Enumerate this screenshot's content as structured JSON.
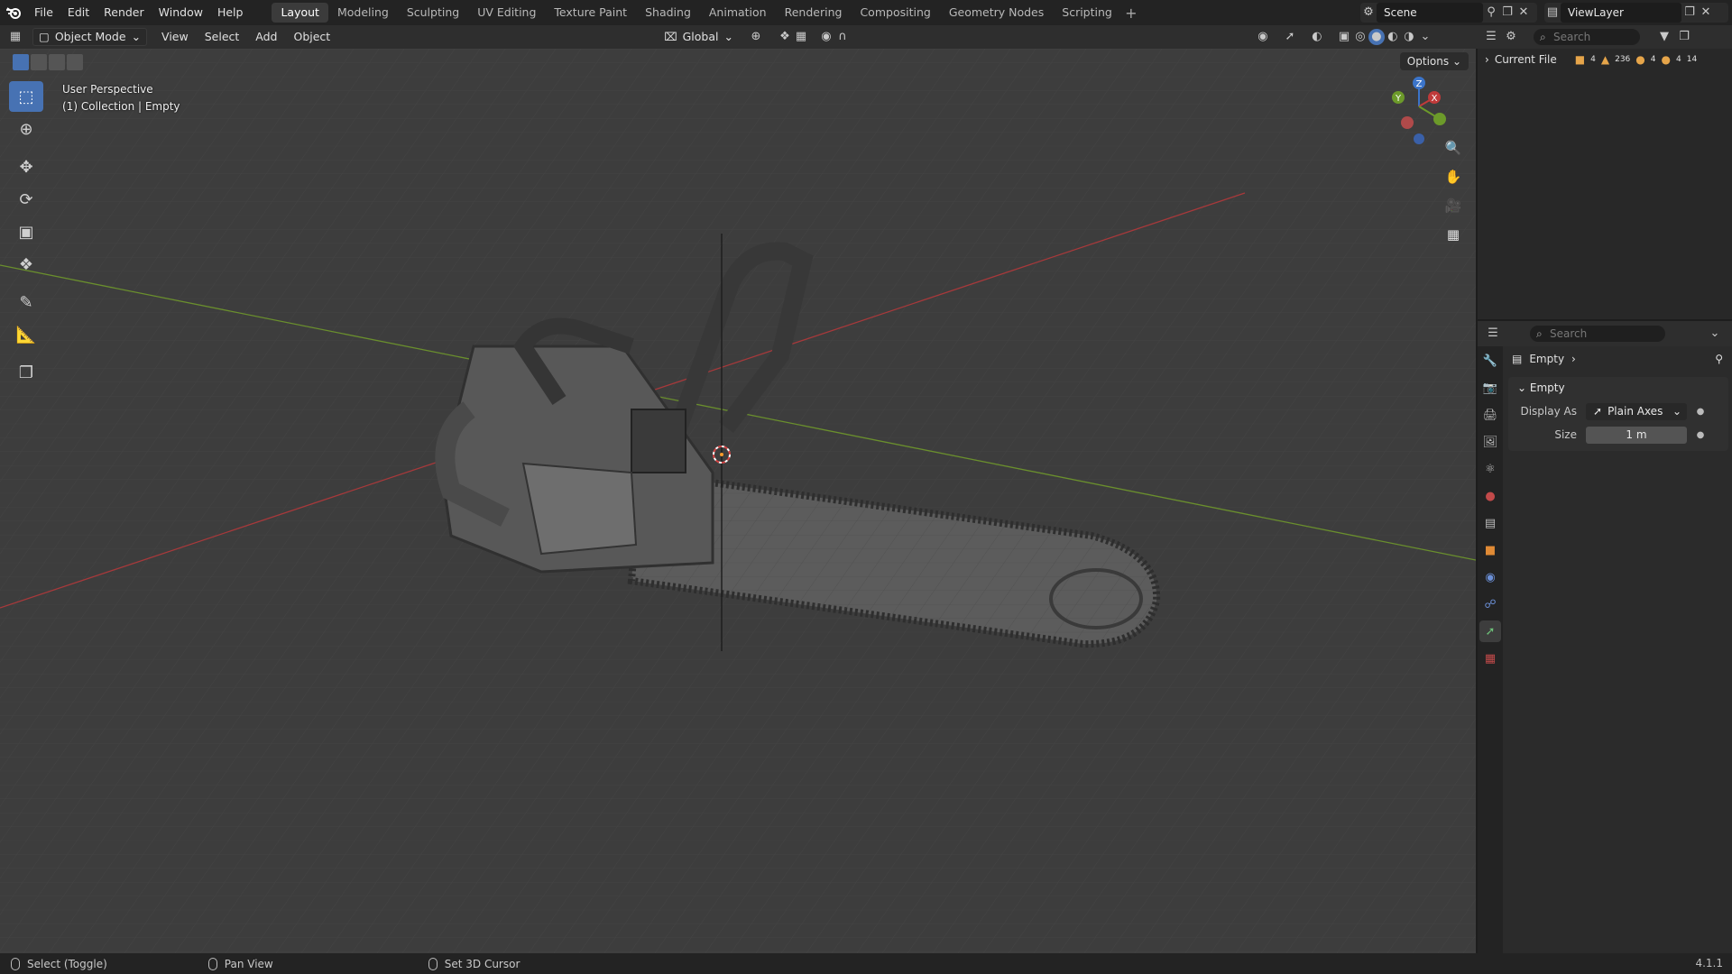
{
  "menu": {
    "items": [
      "File",
      "Edit",
      "Render",
      "Window",
      "Help"
    ]
  },
  "workspaces": {
    "tabs": [
      "Layout",
      "Modeling",
      "Sculpting",
      "UV Editing",
      "Texture Paint",
      "Shading",
      "Animation",
      "Rendering",
      "Compositing",
      "Geometry Nodes",
      "Scripting"
    ],
    "active": "Layout",
    "add_label": "+"
  },
  "scene": {
    "name": "Scene"
  },
  "view_layer": {
    "name": "ViewLayer"
  },
  "viewport_header": {
    "mode": "Object Mode",
    "menus": [
      "View",
      "Select",
      "Add",
      "Object"
    ],
    "orientation": "Global",
    "options_label": "Options"
  },
  "viewport": {
    "perspective_label": "User Perspective",
    "collection_label": "(1) Collection | Empty",
    "gizmo": {
      "x_label": "X",
      "y_label": "Y",
      "z_label": "Z"
    },
    "colors": {
      "x_axis": "#c03a3a",
      "y_axis": "#6c9a2a",
      "z_axis": "#3b74c9",
      "active_tool": "#4772b3"
    }
  },
  "tools": [
    "select-box",
    "cursor",
    "move",
    "rotate",
    "scale",
    "transform",
    "annotate",
    "measure",
    "add-cube"
  ],
  "outliner": {
    "search_placeholder": "Search",
    "current_file": "Current File",
    "counts": [
      "4",
      "236",
      "4",
      "4",
      "14"
    ]
  },
  "properties": {
    "search_placeholder": "Search",
    "object_name": "Empty",
    "panel_title": "Empty",
    "display_as_label": "Display As",
    "display_as_value": "Plain Axes",
    "size_label": "Size",
    "size_value": "1 m"
  },
  "statusbar": {
    "select": "Select (Toggle)",
    "pan": "Pan View",
    "cursor": "Set 3D Cursor",
    "version": "4.1.1"
  }
}
